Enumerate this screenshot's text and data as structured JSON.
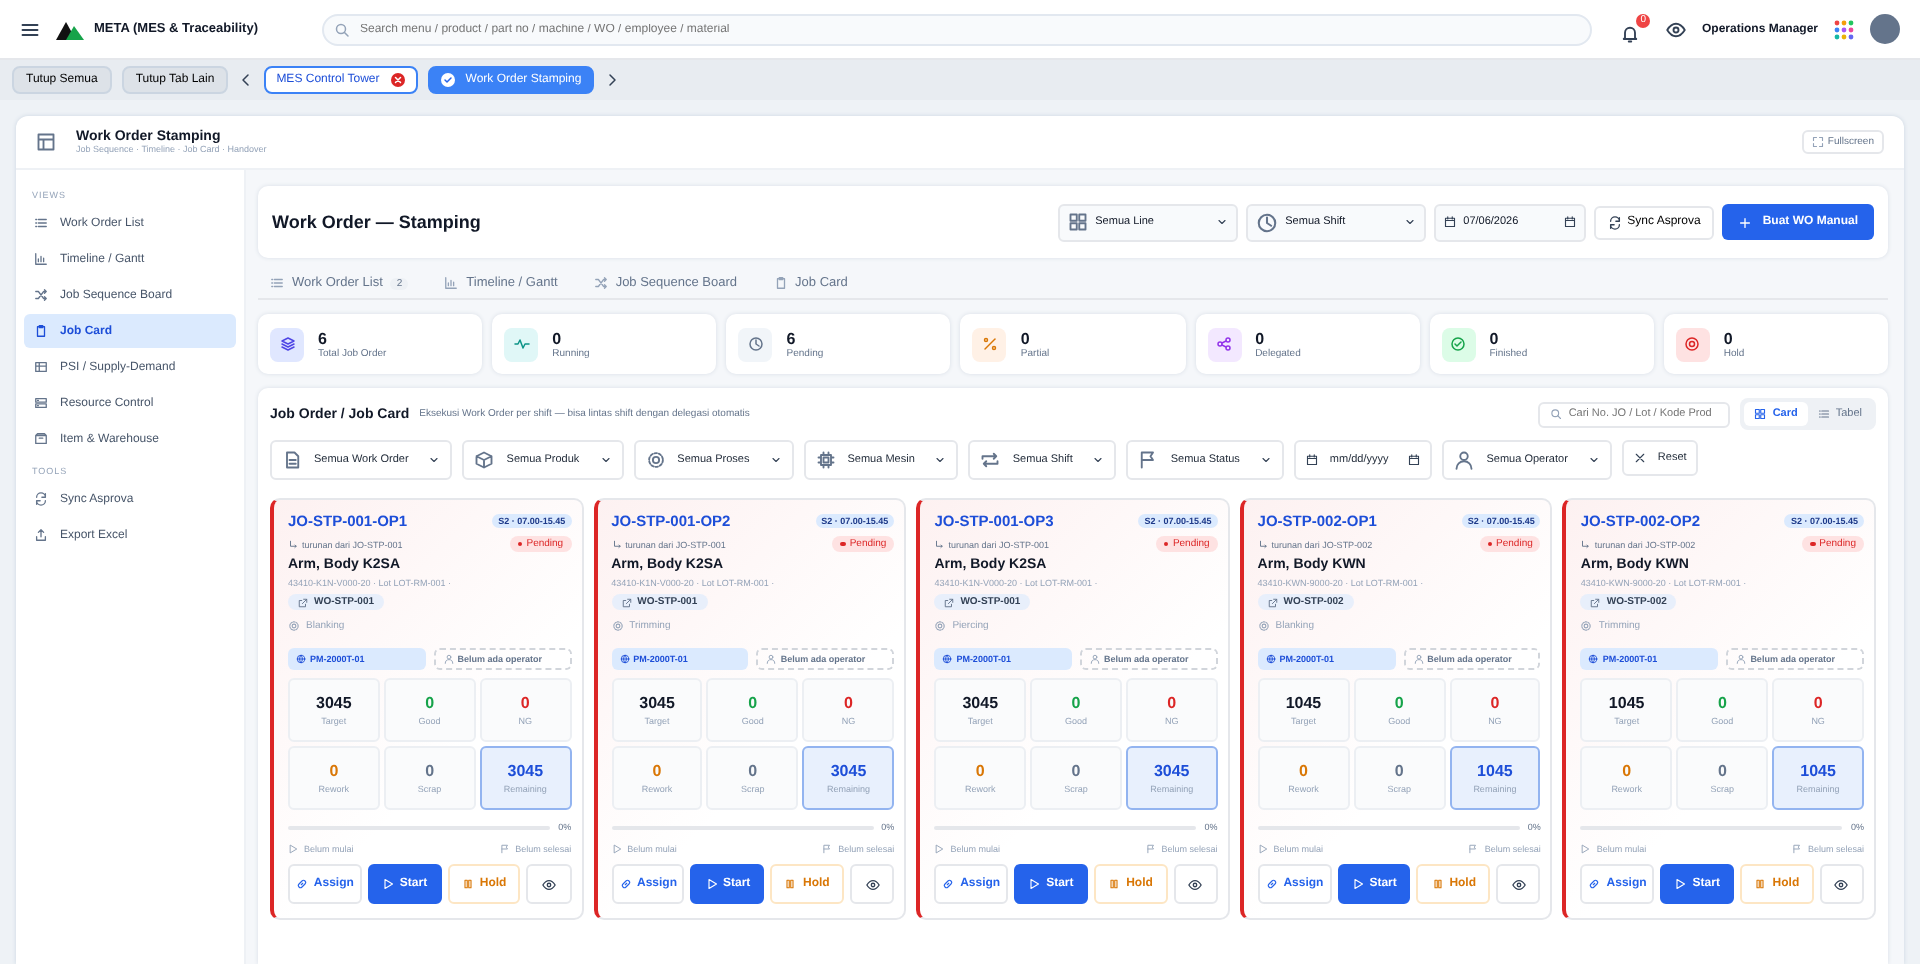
{
  "app": {
    "title": "META (MES & Traceability)",
    "search_placeholder": "Search menu / product / part no / machine / WO / employee / material",
    "notifications": "0",
    "user": "Operations Manager"
  },
  "tab_bar": {
    "buttons": [
      "Tutup Semua",
      "Tutup Tab Lain"
    ],
    "tabs": [
      {
        "label": "MES Control Tower",
        "selected": false
      },
      {
        "label": "Work Order Stamping",
        "selected": true
      }
    ]
  },
  "page": {
    "title": "Work Order Stamping",
    "breadcrumb": "Job Sequence · Timeline · Job Card · Handover",
    "fullscreen": "Fullscreen"
  },
  "sidebar": {
    "sections": [
      {
        "heading": "VIEWS",
        "items": [
          {
            "label": "Work Order List",
            "selected": false
          },
          {
            "label": "Timeline / Gantt",
            "selected": false
          },
          {
            "label": "Job Sequence Board",
            "selected": false
          },
          {
            "label": "Job Card",
            "selected": true
          },
          {
            "label": "PSI / Supply-Demand",
            "selected": false
          },
          {
            "label": "Resource Control",
            "selected": false
          },
          {
            "label": "Item & Warehouse",
            "selected": false
          }
        ]
      },
      {
        "heading": "TOOLS",
        "items": [
          {
            "label": "Sync Asprova",
            "selected": false
          },
          {
            "label": "Export Excel",
            "selected": false
          }
        ]
      }
    ]
  },
  "toolbar": {
    "title": "Work Order — Stamping",
    "line_filter": "Semua Line",
    "shift_filter": "Semua Shift",
    "date": "07/06/2026",
    "sync": "Sync Asprova",
    "create": "Buat WO Manual"
  },
  "view_tabs": [
    {
      "label": "Work Order List",
      "count": "2"
    },
    {
      "label": "Timeline / Gantt"
    },
    {
      "label": "Job Sequence Board"
    },
    {
      "label": "Job Card"
    }
  ],
  "stats": [
    {
      "kind": "total",
      "value": "6",
      "label": "Total Job Order"
    },
    {
      "kind": "running",
      "value": "0",
      "label": "Running"
    },
    {
      "kind": "pending",
      "value": "6",
      "label": "Pending"
    },
    {
      "kind": "partial",
      "value": "0",
      "label": "Partial"
    },
    {
      "kind": "delegated",
      "value": "0",
      "label": "Delegated"
    },
    {
      "kind": "finished",
      "value": "0",
      "label": "Finished"
    },
    {
      "kind": "hold",
      "value": "0",
      "label": "Hold"
    }
  ],
  "job_panel": {
    "title": "Job Order / Job Card",
    "subtitle": "Eksekusi Work Order per shift — bisa lintas shift dengan delegasi otomatis",
    "search_placeholder": "Cari No. JO / Lot / Kode Prod",
    "view_toggle": [
      {
        "label": "Card",
        "selected": true
      },
      {
        "label": "Tabel",
        "selected": false
      }
    ],
    "filters": [
      {
        "kind": "select",
        "label": "Semua Work Order"
      },
      {
        "kind": "select",
        "label": "Semua Produk"
      },
      {
        "kind": "select",
        "label": "Semua Proses"
      },
      {
        "kind": "select",
        "label": "Semua Mesin"
      },
      {
        "kind": "select",
        "label": "Semua Shift"
      },
      {
        "kind": "select",
        "label": "Semua Status"
      },
      {
        "kind": "date",
        "label": "mm/dd/yyyy"
      },
      {
        "kind": "select",
        "label": "Semua Operator"
      },
      {
        "kind": "reset",
        "label": "Reset"
      }
    ]
  },
  "cards": [
    {
      "id": "JO-STP-001-OP1",
      "shift": "S2 · 07.00-15.45",
      "parent": "turunan dari JO-STP-001",
      "status": {
        "kind": "pending",
        "label": "Pending"
      },
      "product": "Arm, Body K2SA",
      "detail": "43410-K1N-V000-20 · Lot LOT-RM-001 ·",
      "wo": "WO-STP-001",
      "process": "Blanking",
      "machine": "PM-2000T-01",
      "operator": "Belum ada operator",
      "metrics": [
        {
          "kind": "target",
          "value": "3045",
          "label": "Target"
        },
        {
          "kind": "good",
          "value": "0",
          "label": "Good"
        },
        {
          "kind": "ng",
          "value": "0",
          "label": "NG"
        },
        {
          "kind": "rework",
          "value": "0",
          "label": "Rework"
        },
        {
          "kind": "scrap",
          "value": "0",
          "label": "Scrap"
        },
        {
          "kind": "remaining",
          "value": "3045",
          "label": "Remaining"
        }
      ],
      "level": 0,
      "progress": "0%",
      "start": "Belum mulai",
      "finish": "Belum selesai",
      "actions": [
        "Assign",
        "Start",
        "Hold"
      ]
    },
    {
      "id": "JO-STP-001-OP2",
      "shift": "S2 · 07.00-15.45",
      "parent": "turunan dari JO-STP-001",
      "status": {
        "kind": "pending",
        "label": "Pending"
      },
      "product": "Arm, Body K2SA",
      "detail": "43410-K1N-V000-20 · Lot LOT-RM-001 ·",
      "wo": "WO-STP-001",
      "process": "Trimming",
      "machine": "PM-2000T-01",
      "operator": "Belum ada operator",
      "metrics": [
        {
          "kind": "target",
          "value": "3045",
          "label": "Target"
        },
        {
          "kind": "good",
          "value": "0",
          "label": "Good"
        },
        {
          "kind": "ng",
          "value": "0",
          "label": "NG"
        },
        {
          "kind": "rework",
          "value": "0",
          "label": "Rework"
        },
        {
          "kind": "scrap",
          "value": "0",
          "label": "Scrap"
        },
        {
          "kind": "remaining",
          "value": "3045",
          "label": "Remaining"
        }
      ],
      "level": 0,
      "progress": "0%",
      "start": "Belum mulai",
      "finish": "Belum selesai",
      "actions": [
        "Assign",
        "Start",
        "Hold"
      ]
    },
    {
      "id": "JO-STP-001-OP3",
      "shift": "S2 · 07.00-15.45",
      "parent": "turunan dari JO-STP-001",
      "status": {
        "kind": "pending",
        "label": "Pending"
      },
      "product": "Arm, Body K2SA",
      "detail": "43410-K1N-V000-20 · Lot LOT-RM-001 ·",
      "wo": "WO-STP-001",
      "process": "Piercing",
      "machine": "PM-2000T-01",
      "operator": "Belum ada operator",
      "metrics": [
        {
          "kind": "target",
          "value": "3045",
          "label": "Target"
        },
        {
          "kind": "good",
          "value": "0",
          "label": "Good"
        },
        {
          "kind": "ng",
          "value": "0",
          "label": "NG"
        },
        {
          "kind": "rework",
          "value": "0",
          "label": "Rework"
        },
        {
          "kind": "scrap",
          "value": "0",
          "label": "Scrap"
        },
        {
          "kind": "remaining",
          "value": "3045",
          "label": "Remaining"
        }
      ],
      "level": 0,
      "progress": "0%",
      "start": "Belum mulai",
      "finish": "Belum selesai",
      "actions": [
        "Assign",
        "Start",
        "Hold"
      ]
    },
    {
      "id": "JO-STP-002-OP1",
      "shift": "S2 · 07.00-15.45",
      "parent": "turunan dari JO-STP-002",
      "status": {
        "kind": "pending",
        "label": "Pending"
      },
      "product": "Arm, Body KWN",
      "detail": "43410-KWN-9000-20 · Lot LOT-RM-001 ·",
      "wo": "WO-STP-002",
      "process": "Blanking",
      "machine": "PM-2000T-01",
      "operator": "Belum ada operator",
      "metrics": [
        {
          "kind": "target",
          "value": "1045",
          "label": "Target"
        },
        {
          "kind": "good",
          "value": "0",
          "label": "Good"
        },
        {
          "kind": "ng",
          "value": "0",
          "label": "NG"
        },
        {
          "kind": "rework",
          "value": "0",
          "label": "Rework"
        },
        {
          "kind": "scrap",
          "value": "0",
          "label": "Scrap"
        },
        {
          "kind": "remaining",
          "value": "1045",
          "label": "Remaining"
        }
      ],
      "level": 0,
      "progress": "0%",
      "start": "Belum mulai",
      "finish": "Belum selesai",
      "actions": [
        "Assign",
        "Start",
        "Hold"
      ]
    },
    {
      "id": "JO-STP-002-OP2",
      "shift": "S2 · 07.00-15.45",
      "parent": "turunan dari JO-STP-002",
      "status": {
        "kind": "pending",
        "label": "Pending"
      },
      "product": "Arm, Body KWN",
      "detail": "43410-KWN-9000-20 · Lot LOT-RM-001 ·",
      "wo": "WO-STP-002",
      "process": "Trimming",
      "machine": "PM-2000T-01",
      "operator": "Belum ada operator",
      "metrics": [
        {
          "kind": "target",
          "value": "1045",
          "label": "Target"
        },
        {
          "kind": "good",
          "value": "0",
          "label": "Good"
        },
        {
          "kind": "ng",
          "value": "0",
          "label": "NG"
        },
        {
          "kind": "rework",
          "value": "0",
          "label": "Rework"
        },
        {
          "kind": "scrap",
          "value": "0",
          "label": "Scrap"
        },
        {
          "kind": "remaining",
          "value": "1045",
          "label": "Remaining"
        }
      ],
      "level": 0,
      "progress": "0%",
      "start": "Belum mulai",
      "finish": "Belum selesai",
      "actions": [
        "Assign",
        "Start",
        "Hold"
      ]
    }
  ]
}
